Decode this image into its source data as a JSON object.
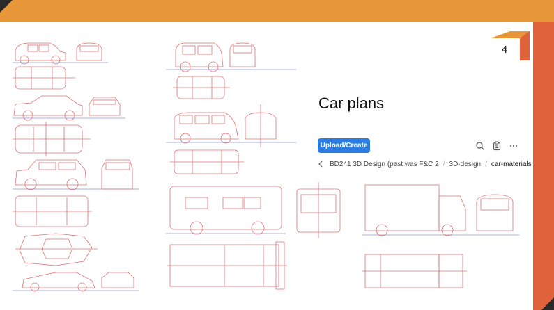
{
  "slide": {
    "page_number": "4",
    "title": "Car plans"
  },
  "toolbar": {
    "upload_label": "Upload/Create",
    "icons": [
      "search-icon",
      "clipboard-icon",
      "more-icon"
    ]
  },
  "breadcrumb": {
    "items": [
      "BD241 3D Design (past was F&C 2",
      "3D-design",
      "car-materials"
    ]
  },
  "colors": {
    "top_band": "#e8963a",
    "right_band": "#e0623a",
    "button": "#2b7de3",
    "drawing_line": "#e07070"
  }
}
